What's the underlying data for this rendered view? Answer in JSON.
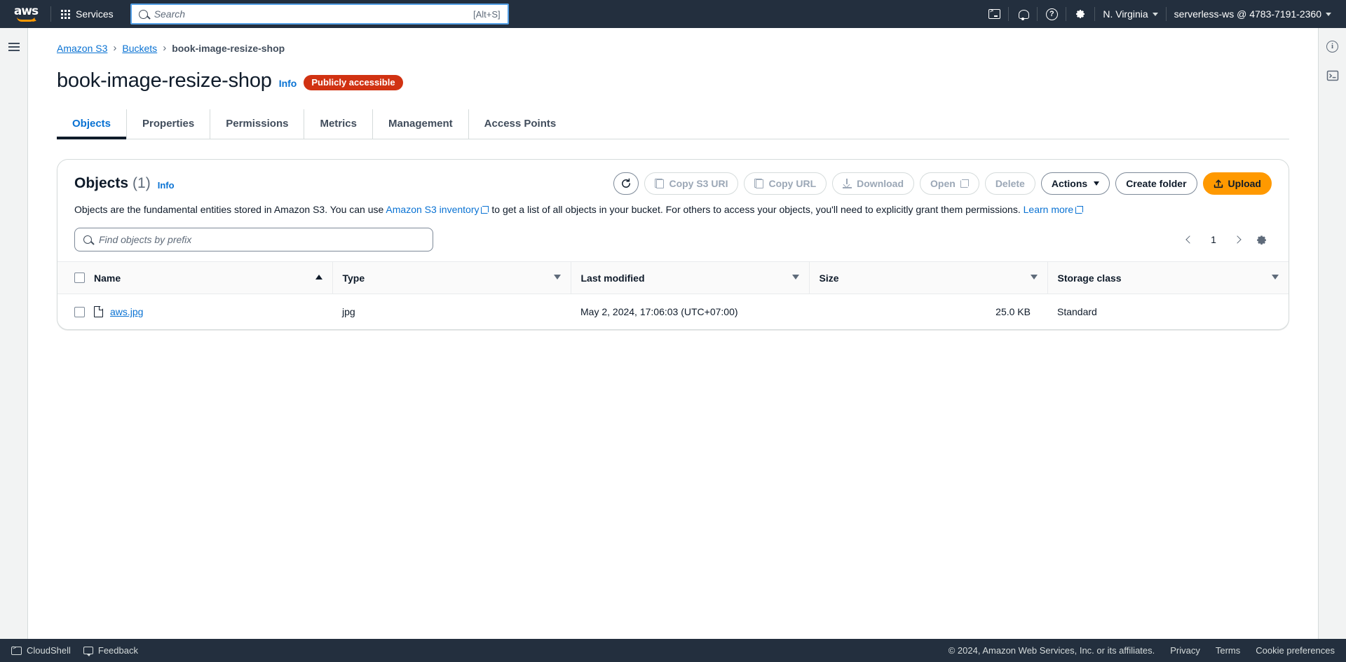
{
  "topnav": {
    "logo_alt": "aws",
    "services_label": "Services",
    "search": {
      "placeholder": "Search",
      "value": "",
      "shortcut": "[Alt+S]"
    },
    "icons": [
      "cloudshell-icon",
      "notifications-bell-icon",
      "help-question-icon",
      "settings-gear-icon"
    ],
    "region_label": "N. Virginia",
    "account_label": "serverless-ws @ 4783-7191-2360"
  },
  "breadcrumb": {
    "items": [
      {
        "label": "Amazon S3",
        "link": true
      },
      {
        "label": "Buckets",
        "link": true
      },
      {
        "label": "book-image-resize-shop",
        "link": false
      }
    ],
    "separator": "›"
  },
  "page": {
    "title": "book-image-resize-shop",
    "info_label": "Info",
    "badge": "Publicly accessible",
    "badge_color": "#d13212"
  },
  "tabs": [
    {
      "label": "Objects",
      "active": true
    },
    {
      "label": "Properties",
      "active": false
    },
    {
      "label": "Permissions",
      "active": false
    },
    {
      "label": "Metrics",
      "active": false
    },
    {
      "label": "Management",
      "active": false
    },
    {
      "label": "Access Points",
      "active": false
    }
  ],
  "objects_panel": {
    "title": "Objects",
    "count": "(1)",
    "info_label": "Info",
    "description_part1": "Objects are the fundamental entities stored in Amazon S3. You can use ",
    "description_link1": "Amazon S3 inventory",
    "description_part2": " to get a list of all objects in your bucket. For others to access your objects, you'll need to explicitly grant them permissions. ",
    "description_link2": "Learn more",
    "buttons": [
      {
        "label": "",
        "name": "refresh-button",
        "icon": "refresh-icon",
        "disabled": false,
        "primary": false
      },
      {
        "label": "Copy S3 URI",
        "name": "copy-s3-uri-button",
        "icon": "copy-icon",
        "disabled": true,
        "primary": false
      },
      {
        "label": "Copy URL",
        "name": "copy-url-button",
        "icon": "copy-icon",
        "disabled": true,
        "primary": false
      },
      {
        "label": "Download",
        "name": "download-button",
        "icon": "download-icon",
        "disabled": true,
        "primary": false
      },
      {
        "label": "Open",
        "name": "open-button",
        "icon": "external-link-icon",
        "disabled": true,
        "primary": false
      },
      {
        "label": "Delete",
        "name": "delete-button",
        "icon": "",
        "disabled": true,
        "primary": false
      },
      {
        "label": "Actions",
        "name": "actions-button",
        "icon": "chevron-down-icon",
        "disabled": false,
        "primary": false
      },
      {
        "label": "Create folder",
        "name": "create-folder-button",
        "icon": "",
        "disabled": false,
        "primary": false
      },
      {
        "label": "Upload",
        "name": "upload-button",
        "icon": "upload-icon",
        "disabled": false,
        "primary": true
      }
    ],
    "search": {
      "placeholder": "Find objects by prefix",
      "value": ""
    },
    "pagination": {
      "prev": "‹",
      "page": "1",
      "next": "›",
      "settings": "preferences-gear-icon"
    },
    "table": {
      "columns": [
        {
          "label": "Name",
          "sort": "asc"
        },
        {
          "label": "Type",
          "sort": "none"
        },
        {
          "label": "Last modified",
          "sort": "none"
        },
        {
          "label": "Size",
          "sort": "none"
        },
        {
          "label": "Storage class",
          "sort": "none"
        }
      ],
      "rows": [
        {
          "name": "aws.jpg",
          "type": "jpg",
          "last_modified": "May 2, 2024, 17:06:03 (UTC+07:00)",
          "size": "25.0 KB",
          "storage_class": "Standard"
        }
      ]
    }
  },
  "footer": {
    "cloudshell_label": "CloudShell",
    "feedback_label": "Feedback",
    "copyright": "© 2024, Amazon Web Services, Inc. or its affiliates.",
    "links": [
      "Privacy",
      "Terms",
      "Cookie preferences"
    ]
  }
}
